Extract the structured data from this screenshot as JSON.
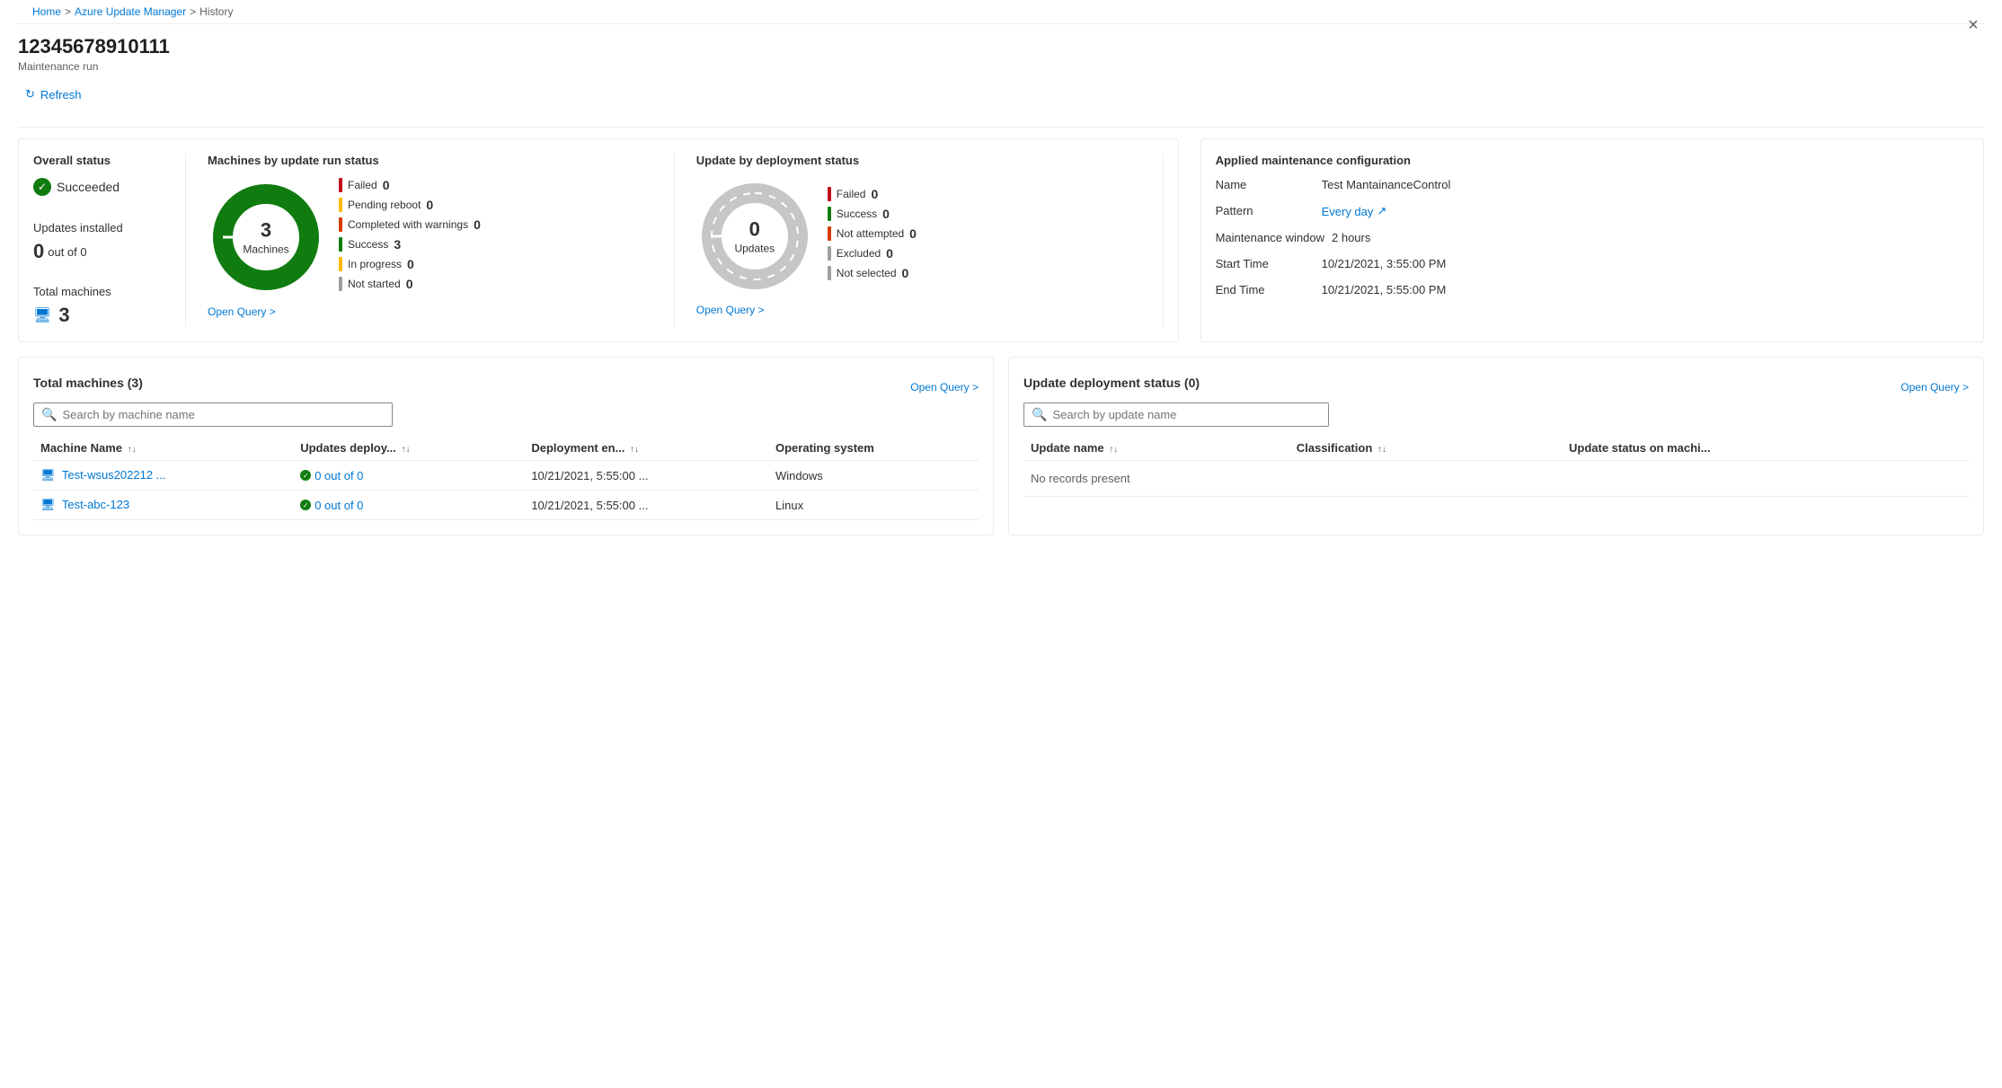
{
  "breadcrumb": {
    "home": "Home",
    "azure_update_manager": "Azure Update Manager",
    "history": "History",
    "sep": ">"
  },
  "page": {
    "title": "12345678910111",
    "subtitle": "Maintenance run",
    "close_label": "×"
  },
  "toolbar": {
    "refresh_label": "Refresh"
  },
  "overall_status": {
    "section_title": "Overall status",
    "status": "Succeeded",
    "updates_installed_label": "Updates installed",
    "updates_count": "0",
    "updates_out_of": "out of 0",
    "total_machines_label": "Total machines",
    "total_machines_count": "3"
  },
  "machines_chart": {
    "section_title": "Machines by update run status",
    "donut_number": "3",
    "donut_text": "Machines",
    "legend": [
      {
        "label": "Failed",
        "value": "0",
        "color": "#c50f1f"
      },
      {
        "label": "Pending reboot",
        "value": "0",
        "color": "#ffb900"
      },
      {
        "label": "Completed with warnings",
        "value": "0",
        "color": "#d83b01"
      },
      {
        "label": "Success",
        "value": "3",
        "color": "#107c10"
      },
      {
        "label": "In progress",
        "value": "0",
        "color": "#ffb900"
      },
      {
        "label": "Not started",
        "value": "0",
        "color": "#a19f9d"
      }
    ],
    "open_query": "Open Query >"
  },
  "deployment_chart": {
    "section_title": "Update by deployment status",
    "donut_number": "0",
    "donut_text": "Updates",
    "legend": [
      {
        "label": "Failed",
        "value": "0",
        "color": "#c50f1f"
      },
      {
        "label": "Success",
        "value": "0",
        "color": "#107c10"
      },
      {
        "label": "Not attempted",
        "value": "0",
        "color": "#d83b01"
      },
      {
        "label": "Excluded",
        "value": "0",
        "color": "#a19f9d"
      },
      {
        "label": "Not selected",
        "value": "0",
        "color": "#a19f9d"
      }
    ],
    "open_query": "Open Query >"
  },
  "maintenance": {
    "section_title": "Applied maintenance configuration",
    "name_label": "Name",
    "name_prefix": "Test",
    "name_value": "MantainanceControl",
    "pattern_label": "Pattern",
    "pattern_value": "Every day",
    "window_label": "Maintenance window",
    "window_value": "2 hours",
    "start_label": "Start Time",
    "start_value": "10/21/2021, 3:55:00 PM",
    "end_label": "End Time",
    "end_value": "10/21/2021, 5:55:00 PM"
  },
  "machines_table": {
    "title": "Total machines (3)",
    "open_query": "Open Query >",
    "search_placeholder": "Search by machine name",
    "columns": [
      {
        "label": "Machine Name",
        "sortable": true
      },
      {
        "label": "Updates deploy...",
        "sortable": true
      },
      {
        "label": "Deployment en...",
        "sortable": true
      },
      {
        "label": "Operating system",
        "sortable": false
      }
    ],
    "rows": [
      {
        "machine": "Test-wsus202212 ...",
        "updates": "0 out of 0",
        "deployment_end": "10/21/2021, 5:55:00 ...",
        "os": "Windows"
      },
      {
        "machine": "Test-abc-123",
        "updates": "0 out of 0",
        "deployment_end": "10/21/2021, 5:55:00 ...",
        "os": "Linux"
      }
    ]
  },
  "updates_table": {
    "title": "Update deployment status (0)",
    "open_query": "Open Query >",
    "search_placeholder": "Search by update name",
    "columns": [
      {
        "label": "Update name",
        "sortable": true
      },
      {
        "label": "Classification",
        "sortable": true
      },
      {
        "label": "Update status on machi...",
        "sortable": false
      }
    ],
    "no_records": "No records present"
  }
}
